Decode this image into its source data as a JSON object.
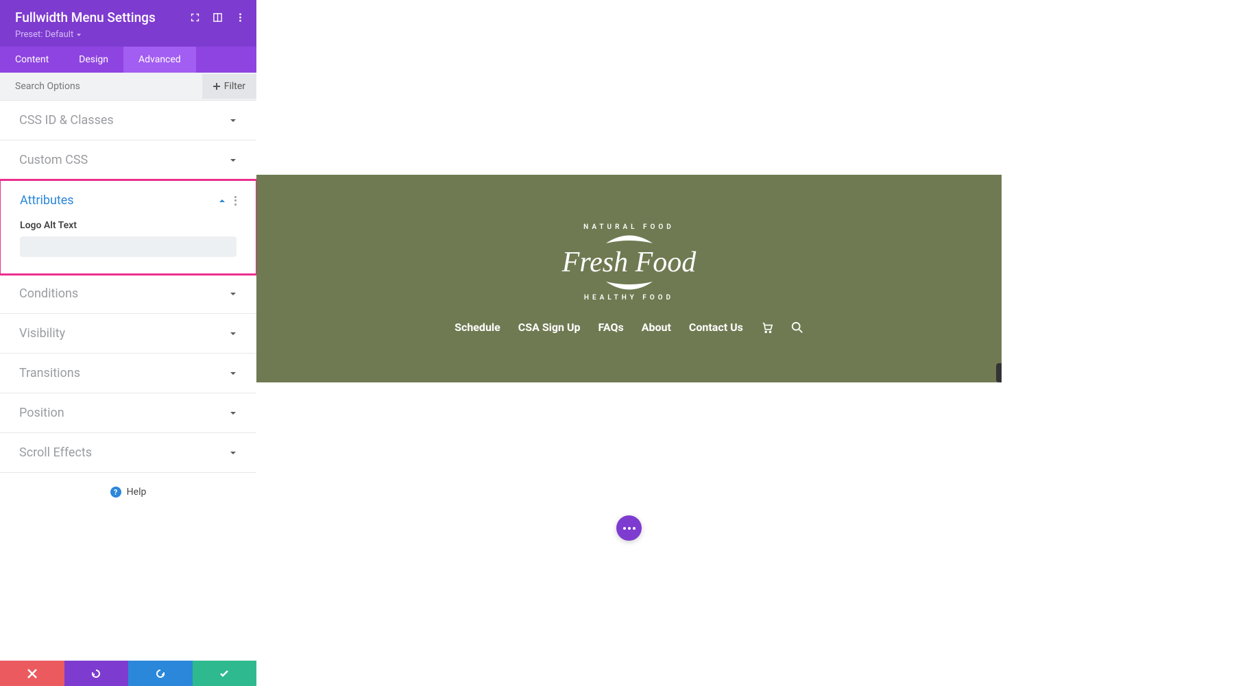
{
  "header": {
    "title": "Fullwidth Menu Settings",
    "preset_label": "Preset: Default"
  },
  "tabs": [
    {
      "label": "Content",
      "active": false
    },
    {
      "label": "Design",
      "active": false
    },
    {
      "label": "Advanced",
      "active": true
    }
  ],
  "search": {
    "placeholder": "Search Options",
    "filter_label": "Filter"
  },
  "sections": {
    "css_id_classes": "CSS ID & Classes",
    "custom_css": "Custom CSS",
    "attributes": "Attributes",
    "attributes_field_label": "Logo Alt Text",
    "conditions": "Conditions",
    "visibility": "Visibility",
    "transitions": "Transitions",
    "position": "Position",
    "scroll_effects": "Scroll Effects"
  },
  "help_label": "Help",
  "preview": {
    "logo_top": "NATURAL FOOD",
    "logo_main": "Fresh Food",
    "logo_bottom": "HEALTHY FOOD",
    "menu": [
      "Schedule",
      "CSA Sign Up",
      "FAQs",
      "About",
      "Contact Us"
    ]
  }
}
